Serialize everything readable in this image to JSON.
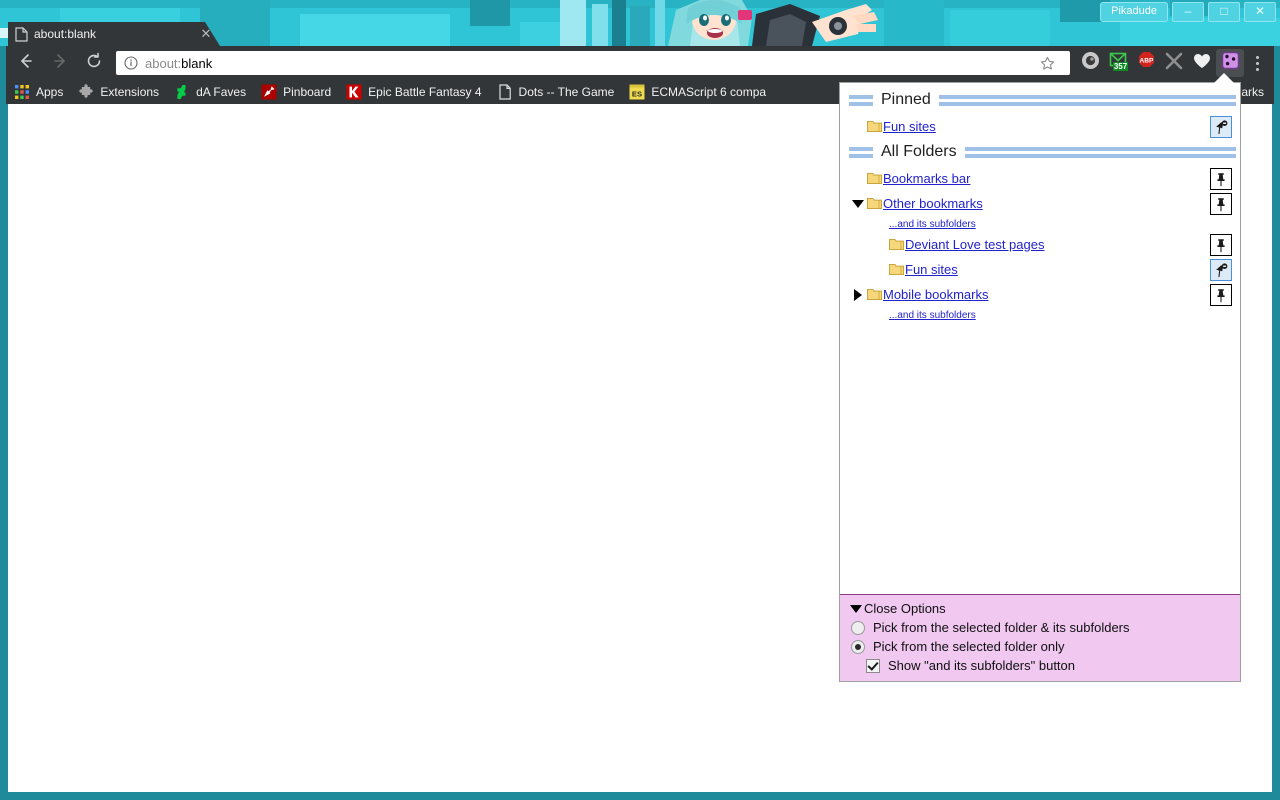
{
  "window": {
    "profile_label": "Pikadude",
    "minimize_label": "–",
    "maximize_label": "□",
    "close_label": "✕"
  },
  "tab": {
    "title": "about:blank",
    "close_label": "✕",
    "favicon": "page-icon"
  },
  "toolbar": {
    "back_icon": "back-arrow-icon",
    "forward_icon": "forward-arrow-icon",
    "reload_icon": "reload-icon",
    "omnibox": {
      "info_icon": "page-info-icon",
      "scheme": "about:",
      "rest": "blank",
      "full_value": "about:blank"
    },
    "star_icon": "bookmark-star-icon",
    "menu_icon": "chrome-menu-icon",
    "extensions": [
      {
        "name": "dark-circle-extension",
        "badge": ""
      },
      {
        "name": "gmail-checker-extension",
        "badge": "357"
      },
      {
        "name": "adblock-plus-extension",
        "badge": "",
        "label": "ABP"
      },
      {
        "name": "gray-x-extension",
        "badge": ""
      },
      {
        "name": "heart-extension",
        "badge": ""
      },
      {
        "name": "random-bookmark-dice-extension",
        "badge": "",
        "active": true
      }
    ]
  },
  "bookmarks_bar": {
    "items": [
      {
        "label": "Apps",
        "icon": "apps-grid-icon"
      },
      {
        "label": "Extensions",
        "icon": "extension-puzzle-icon"
      },
      {
        "label": "dA Faves",
        "icon": "deviantart-icon"
      },
      {
        "label": "Pinboard",
        "icon": "pinboard-icon"
      },
      {
        "label": "Epic Battle Fantasy 4",
        "icon": "kongregate-icon"
      },
      {
        "label": "Dots -- The Game",
        "icon": "page-icon"
      },
      {
        "label": "ECMAScript 6 compa",
        "icon": "es6-icon"
      }
    ],
    "overflow_label": "Other bookmarks"
  },
  "popup": {
    "sections": [
      {
        "id": "pinned",
        "title": "Pinned",
        "rows": [
          {
            "label": "Fun sites",
            "indent": 1,
            "twisty": "none",
            "subfolders_label": "",
            "pin_state": "pinned",
            "pin_icon": "unpin-icon"
          }
        ]
      },
      {
        "id": "all-folders",
        "title": "All Folders",
        "rows": [
          {
            "label": "Bookmarks bar",
            "indent": 1,
            "twisty": "none",
            "subfolders_label": "",
            "pin_state": "unpinned",
            "pin_icon": "pin-icon"
          },
          {
            "label": "Other bookmarks",
            "indent": 1,
            "twisty": "expanded",
            "subfolders_label": "...and its subfolders",
            "pin_state": "unpinned",
            "pin_icon": "pin-icon"
          },
          {
            "label": "Deviant Love test pages",
            "indent": 2,
            "twisty": "none",
            "subfolders_label": "",
            "pin_state": "unpinned",
            "pin_icon": "pin-icon"
          },
          {
            "label": "Fun sites",
            "indent": 2,
            "twisty": "none",
            "subfolders_label": "",
            "pin_state": "pinned",
            "pin_icon": "unpin-icon"
          },
          {
            "label": "Mobile bookmarks",
            "indent": 1,
            "twisty": "collapsed",
            "subfolders_label": "...and its subfolders",
            "pin_state": "unpinned",
            "pin_icon": "pin-icon"
          }
        ]
      }
    ],
    "options": {
      "title": "Close Options",
      "collapse_icon": "triangle-down-icon",
      "items": [
        {
          "type": "radio",
          "label": "Pick from the selected folder & its subfolders",
          "checked": false,
          "indent": false
        },
        {
          "type": "radio",
          "label": "Pick from the selected folder only",
          "checked": true,
          "indent": false
        },
        {
          "type": "checkbox",
          "label": "Show \"and its subfolders\" button",
          "checked": true,
          "indent": true
        }
      ]
    }
  },
  "colors": {
    "theme_accent": "#2fc4d6",
    "chrome_frame": "#323639",
    "link": "#2222cc",
    "rule": "#9fc1e8",
    "options_bg": "#f0c8f0",
    "options_border": "#8a3a8a",
    "folder": "#f5d76e",
    "pin_active_bg": "#ddeaf7",
    "pin_active_border": "#4a90d9"
  }
}
